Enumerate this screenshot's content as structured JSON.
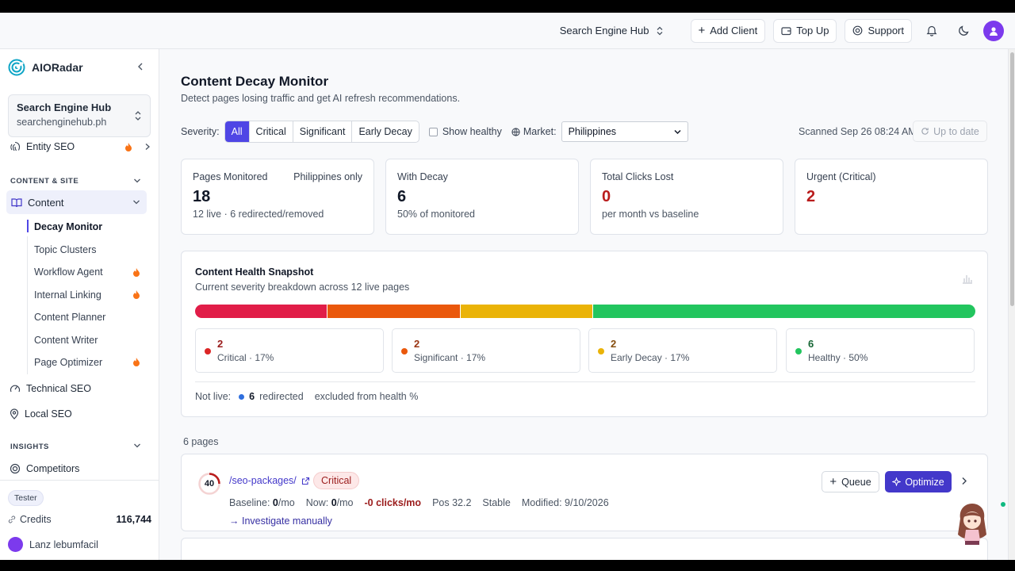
{
  "header": {
    "workspace": "Search Engine Hub",
    "add_client": "Add Client",
    "top_up": "Top Up",
    "support": "Support",
    "icons": [
      "bell-icon",
      "moon-icon",
      "user-avatar"
    ]
  },
  "sidebar": {
    "brand": "AIORadar",
    "workspace": {
      "name": "Search Engine Hub",
      "domain": "searchenginehub.ph"
    },
    "entity_seo": "Entity SEO",
    "section_content_site": "CONTENT & SITE",
    "content": "Content",
    "content_items": [
      {
        "label": "Decay Monitor",
        "active": true,
        "flame": false
      },
      {
        "label": "Topic Clusters",
        "active": false,
        "flame": false
      },
      {
        "label": "Workflow Agent",
        "active": false,
        "flame": true
      },
      {
        "label": "Internal Linking",
        "active": false,
        "flame": true
      },
      {
        "label": "Content Planner",
        "active": false,
        "flame": false
      },
      {
        "label": "Content Writer",
        "active": false,
        "flame": false
      },
      {
        "label": "Page Optimizer",
        "active": false,
        "flame": true
      }
    ],
    "technical_seo": "Technical SEO",
    "local_seo": "Local SEO",
    "section_insights": "INSIGHTS",
    "competitors": "Competitors",
    "tester_badge": "Tester",
    "credits_label": "Credits",
    "credits_value": "116,744",
    "user_name": "Lanz lebumfacil"
  },
  "main": {
    "title": "Content Decay Monitor",
    "subtitle": "Detect pages losing traffic and get AI refresh recommendations.",
    "filters": {
      "severity_label": "Severity:",
      "severity_options": [
        "All",
        "Critical",
        "Significant",
        "Early Decay"
      ],
      "selected": "All",
      "show_healthy": "Show healthy",
      "market_label": "Market:",
      "market_value": "Philippines"
    },
    "scanned": "Scanned Sep 26 08:24 AM",
    "up_to_date": "Up to date",
    "stats": [
      {
        "label": "Pages Monitored",
        "aside": "Philippines only",
        "value": "18",
        "hint": "12 live · 6 redirected/removed"
      },
      {
        "label": "With Decay",
        "aside": "",
        "value": "6",
        "hint": "50% of monitored"
      },
      {
        "label": "Total Clicks Lost",
        "aside": "",
        "value": "0",
        "hint": "per month vs baseline"
      },
      {
        "label": "Urgent (Critical)",
        "aside": "",
        "value": "2",
        "hint": ""
      }
    ],
    "health": {
      "title": "Content Health Snapshot",
      "subtitle": "Current severity breakdown across 12 live pages",
      "bar": [
        {
          "name": "Critical",
          "fraction": 0.17,
          "color": "#e11d48"
        },
        {
          "name": "Significant",
          "fraction": 0.17,
          "color": "#ea580c"
        },
        {
          "name": "Early Decay",
          "fraction": 0.17,
          "color": "#eab308"
        },
        {
          "name": "Healthy",
          "fraction": 0.49,
          "color": "#22c55e"
        }
      ],
      "cards": [
        {
          "count": "2",
          "label": "Critical · 17%",
          "color": "#dc2626",
          "text_color": "#991b1b"
        },
        {
          "count": "2",
          "label": "Significant · 17%",
          "color": "#ea580c",
          "text_color": "#9a3412"
        },
        {
          "count": "2",
          "label": "Early Decay · 17%",
          "color": "#eab308",
          "text_color": "#854d0e"
        },
        {
          "count": "6",
          "label": "Healthy · 50%",
          "color": "#22c55e",
          "text_color": "#166534"
        }
      ],
      "not_live_label": "Not live:",
      "not_live_count": "6",
      "not_live_status": "redirected",
      "not_live_note": "excluded from health %"
    },
    "pages_count": "6 pages",
    "rows": [
      {
        "score": "40",
        "url": "/seo-packages/",
        "severity": "Critical",
        "baseline_label": "Baseline:",
        "baseline_value": "0",
        "baseline_unit": "/mo",
        "now_label": "Now:",
        "now_value": "0",
        "now_unit": "/mo",
        "delta": "-0 clicks/mo",
        "pos": "Pos 32.2",
        "trend": "Stable",
        "modified": "Modified: 9/10/2026",
        "action": "→ Investigate manually",
        "queue": "Queue",
        "optimize": "Optimize"
      }
    ]
  }
}
